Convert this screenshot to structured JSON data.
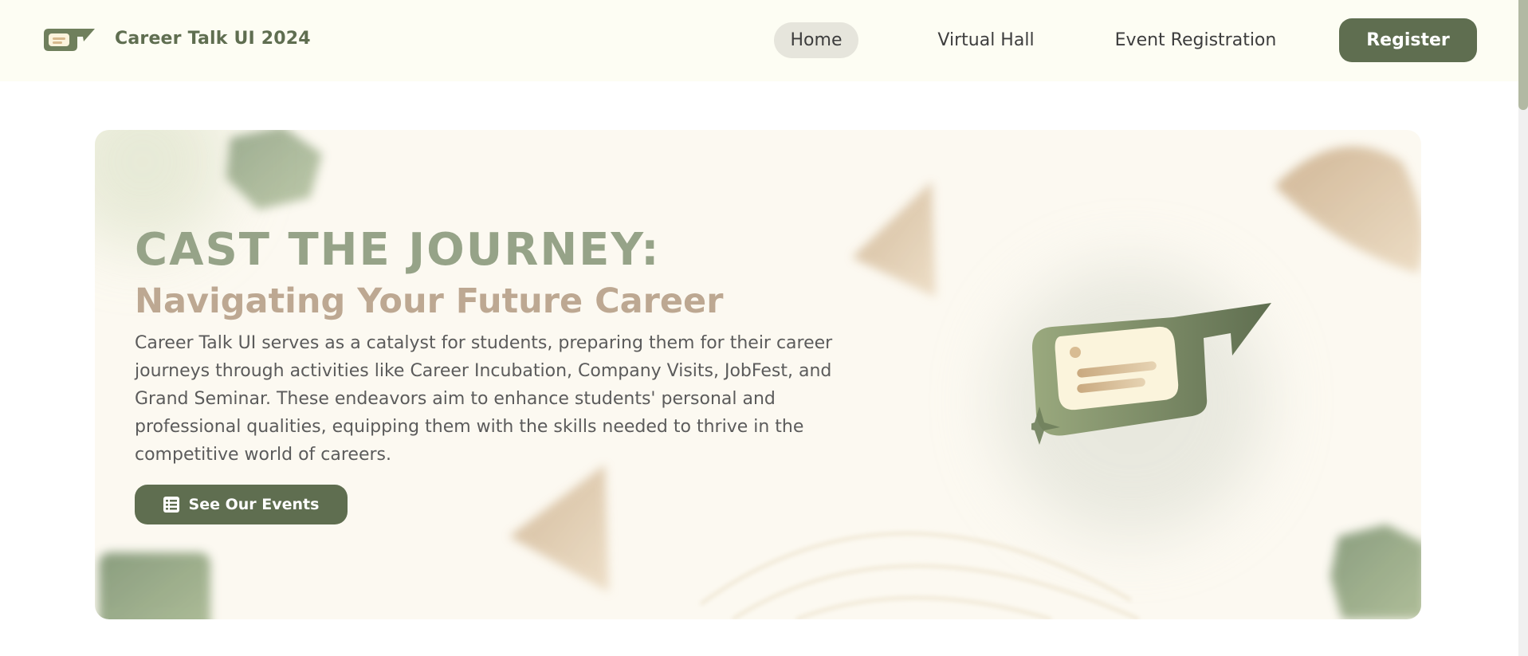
{
  "navbar": {
    "brand_name": "Career Talk UI 2024",
    "brand_icon": "chat-bubble-logo-icon",
    "links": [
      {
        "label": "Home",
        "active": true
      },
      {
        "label": "Virtual Hall",
        "active": false
      },
      {
        "label": "Event Registration",
        "active": false
      }
    ],
    "register_label": "Register"
  },
  "hero": {
    "title": "CAST THE JOURNEY:",
    "subtitle": "Navigating Your Future Career",
    "description": "Career Talk UI serves as a catalyst for students, preparing them for their career journeys through activities like Career Incubation, Company Visits, JobFest, and Grand Seminar. These endeavors aim to enhance students' personal and professional qualities, equipping them with the skills needed to thrive in the competitive world of careers.",
    "cta_label": "See Our Events",
    "cta_icon": "list-icon",
    "illustration_icon": "chat-bubble-logo-icon"
  },
  "colors": {
    "primary": "#5f6e50",
    "title": "#96a388",
    "subtitle": "#bda892",
    "nav_background": "#fdfdf3",
    "hero_background": "#fcf9f1"
  }
}
